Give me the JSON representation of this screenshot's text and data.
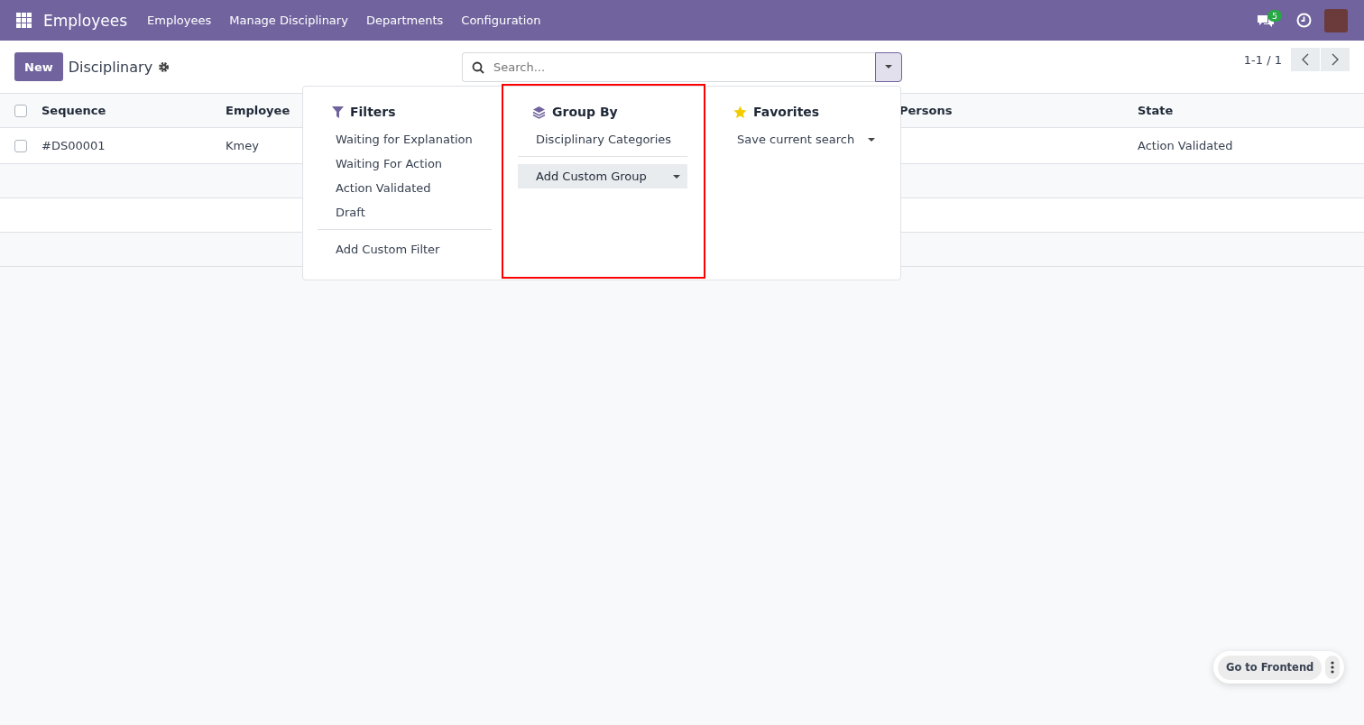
{
  "navbar": {
    "app_name": "Employees",
    "menu": [
      "Employees",
      "Manage Disciplinary",
      "Departments",
      "Configuration"
    ],
    "messages_badge": "5"
  },
  "control_panel": {
    "new_button": "New",
    "title": "Disciplinary",
    "search": {
      "placeholder": "Search..."
    },
    "pager": "1-1 / 1"
  },
  "table": {
    "all_selected": false,
    "columns": [
      "Sequence",
      "Employee",
      "Persons",
      "State"
    ],
    "rows": [
      {
        "cells": [
          "#DS00001",
          "Kmey",
          "",
          "Action Validated"
        ],
        "selected": false
      }
    ]
  },
  "search_panel": {
    "filters": {
      "title": "Filters",
      "items": [
        "Waiting for Explanation",
        "Waiting For Action",
        "Action Validated",
        "Draft"
      ],
      "custom": "Add Custom Filter"
    },
    "group_by": {
      "title": "Group By",
      "items": [
        "Disciplinary Categories"
      ],
      "custom": "Add Custom Group",
      "highlighted": true
    },
    "favorites": {
      "title": "Favorites",
      "items": [
        "Save current search"
      ]
    }
  },
  "floating": {
    "button": "Go to Frontend"
  }
}
